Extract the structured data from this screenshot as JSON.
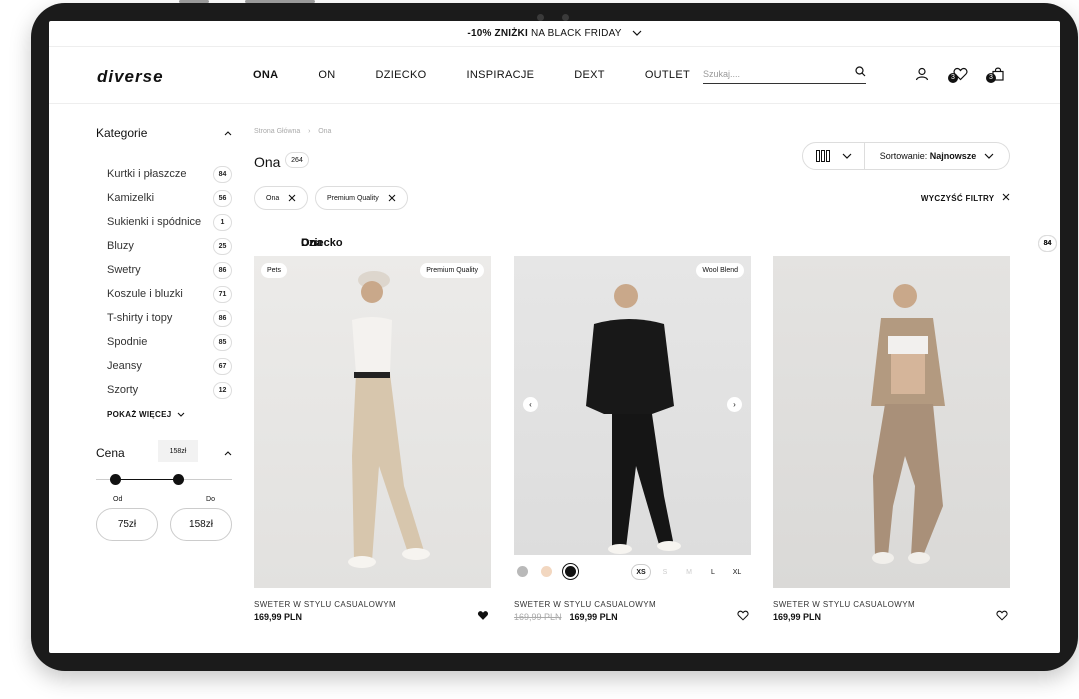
{
  "promo": {
    "bold": "-10% ZNIŻKI",
    "rest": "NA BLACK FRIDAY"
  },
  "header": {
    "logo": "diverse",
    "nav": [
      "ONA",
      "ON",
      "DZIECKO",
      "INSPIRACJE",
      "DEXT",
      "OUTLET"
    ],
    "active_nav": "ONA",
    "search_placeholder": "Szukaj....",
    "wishlist_count": "3",
    "cart_count": "3"
  },
  "sidebar": {
    "categories_title": "Kategorie",
    "ona": {
      "label": "Ona",
      "count": "84"
    },
    "sub": [
      {
        "label": "Kurtki i płaszcze",
        "count": "84"
      },
      {
        "label": "Kamizelki",
        "count": "56"
      },
      {
        "label": "Sukienki i spódnice",
        "count": "1"
      },
      {
        "label": "Bluzy",
        "count": "25"
      },
      {
        "label": "Swetry",
        "count": "86"
      },
      {
        "label": "Koszule i bluzki",
        "count": "71"
      },
      {
        "label": "T-shirty i topy",
        "count": "86"
      },
      {
        "label": "Spodnie",
        "count": "85"
      },
      {
        "label": "Jeansy",
        "count": "67"
      },
      {
        "label": "Szorty",
        "count": "12"
      }
    ],
    "show_more": "POKAŻ WIĘCEJ",
    "on": {
      "label": "On",
      "count": "84"
    },
    "dziecko": {
      "label": "Dziecko",
      "count": "84"
    },
    "price_title": "Cena",
    "price_tooltip": "158zł",
    "from_label": "Od",
    "to_label": "Do",
    "from_value": "75zł",
    "to_value": "158zł",
    "price_range_fraction": [
      0.14,
      0.6
    ]
  },
  "main": {
    "breadcrumb": [
      "Strona Główna",
      "Ona"
    ],
    "title": "Ona",
    "count": "264",
    "sort_label": "Sortowanie:",
    "sort_value": "Najnowsze",
    "chips": [
      "Ona",
      "Premium Quality"
    ],
    "clear_filters": "WYCZYŚĆ FILTRY",
    "products": [
      {
        "tags": [
          "Pets",
          "Premium Quality"
        ],
        "name": "SWETER W STYLU CASUALOWYM",
        "price": "169,99 PLN",
        "old_price": "",
        "liked": true
      },
      {
        "tags": [
          "Wool Blend"
        ],
        "name": "SWETER W STYLU CASUALOWYM",
        "price": "169,99 PLN",
        "old_price": "169,99 PLN",
        "liked": false,
        "swatch_colors": [
          "#b9b9b9",
          "#f2d7c0",
          "#111111"
        ],
        "sizes": [
          "XS",
          "S",
          "M",
          "L",
          "XL"
        ],
        "selected_size": "XS",
        "unavailable_sizes": [
          "S",
          "M"
        ]
      },
      {
        "tags": [],
        "name": "SWETER W STYLU CASUALOWYM",
        "price": "169,99 PLN",
        "old_price": "",
        "liked": false
      }
    ]
  }
}
